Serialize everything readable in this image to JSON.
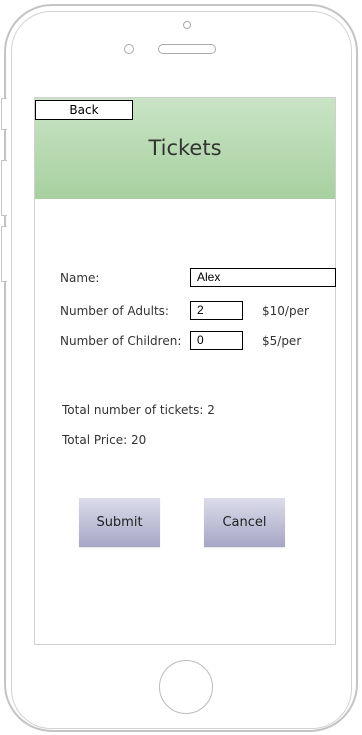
{
  "header": {
    "back_label": "Back",
    "title": "Tickets"
  },
  "form": {
    "name_label": "Name:",
    "name_value": "Alex",
    "adults_label": "Number of Adults:",
    "adults_value": "2",
    "adults_price": "$10/per",
    "children_label": "Number of Children:",
    "children_value": "0",
    "children_price": "$5/per"
  },
  "summary": {
    "total_tickets": "Total number of tickets: 2",
    "total_price": "Total Price: 20"
  },
  "actions": {
    "submit_label": "Submit",
    "cancel_label": "Cancel"
  }
}
